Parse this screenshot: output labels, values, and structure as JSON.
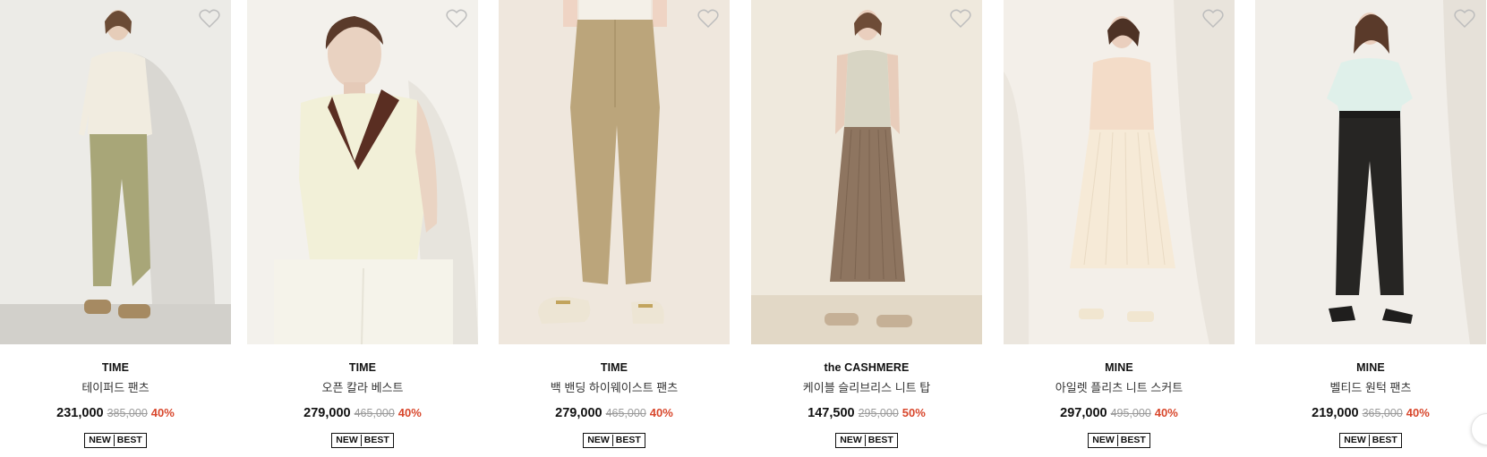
{
  "products": [
    {
      "brand": "TIME",
      "name": "테이퍼드 팬츠",
      "price": "231,000",
      "original_price": "385,000",
      "discount": "40%",
      "badges": [
        "NEW",
        "BEST"
      ],
      "wishlist_icon": "heart-outline-icon"
    },
    {
      "brand": "TIME",
      "name": "오픈 칼라 베스트",
      "price": "279,000",
      "original_price": "465,000",
      "discount": "40%",
      "badges": [
        "NEW",
        "BEST"
      ],
      "wishlist_icon": "heart-outline-icon"
    },
    {
      "brand": "TIME",
      "name": "백 밴딩 하이웨이스트 팬츠",
      "price": "279,000",
      "original_price": "465,000",
      "discount": "40%",
      "badges": [
        "NEW",
        "BEST"
      ],
      "wishlist_icon": "heart-outline-icon"
    },
    {
      "brand": "the CASHMERE",
      "name": "케이블 슬리브리스 니트 탑",
      "price": "147,500",
      "original_price": "295,000",
      "discount": "50%",
      "badges": [
        "NEW",
        "BEST"
      ],
      "wishlist_icon": "heart-outline-icon"
    },
    {
      "brand": "MINE",
      "name": "아일렛 플리츠 니트 스커트",
      "price": "297,000",
      "original_price": "495,000",
      "discount": "40%",
      "badges": [
        "NEW",
        "BEST"
      ],
      "wishlist_icon": "heart-outline-icon"
    },
    {
      "brand": "MINE",
      "name": "벨티드 원턱 팬츠",
      "price": "219,000",
      "original_price": "365,000",
      "discount": "40%",
      "badges": [
        "NEW",
        "BEST"
      ],
      "wishlist_icon": "heart-outline-icon"
    }
  ],
  "colors": {
    "discount": "#d8472c",
    "original_price": "#9a9a9a",
    "text": "#111111"
  }
}
